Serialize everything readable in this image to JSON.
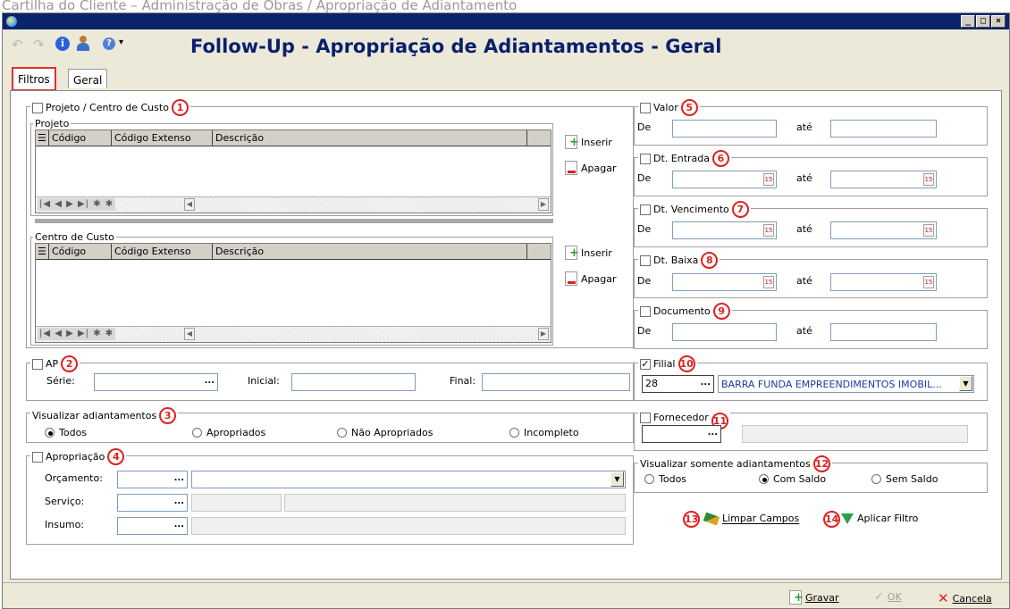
{
  "caption": "Cartilha do Cliente – Administração de Obras / Apropriação de Adiantamento",
  "window": {
    "buttons": [
      "_",
      "□",
      "×"
    ]
  },
  "toolbar": {
    "title": "Follow-Up - Apropriação de Adiantamentos - Geral",
    "help_arrow": "▾"
  },
  "tabs": [
    {
      "label": "Filtros"
    },
    {
      "label": "Geral"
    }
  ],
  "projeto_centro": {
    "label": "Projeto / Centro de Custo",
    "num": "1",
    "projeto": {
      "title": "Projeto",
      "columns": [
        "Código",
        "Código Extenso",
        "Descrição"
      ]
    },
    "centro": {
      "title": "Centro de Custo",
      "columns": [
        "Código",
        "Código Extenso",
        "Descrição"
      ]
    },
    "nav": "|◀ ◀ ▶ ▶| ✱ ✱",
    "inserir": "Inserir",
    "apagar": "Apagar"
  },
  "ap": {
    "label": "AP",
    "num": "2",
    "serie": "Série:",
    "inicial": "Inicial:",
    "final": "Final:",
    "dots": "..."
  },
  "visualizar": {
    "label": "Visualizar adiantamentos",
    "num": "3",
    "options": [
      {
        "label": "Todos",
        "selected": true
      },
      {
        "label": "Apropriados",
        "selected": false
      },
      {
        "label": "Não Apropriados",
        "selected": false
      },
      {
        "label": "Incompleto",
        "selected": false
      }
    ]
  },
  "apropriacao": {
    "label": "Apropriação",
    "num": "4",
    "orcamento": "Orçamento:",
    "servico": "Serviço:",
    "insumo": "Insumo:",
    "dots": "..."
  },
  "valor": {
    "label": "Valor",
    "num": "5",
    "de": "De",
    "ate": "até"
  },
  "dt_entrada": {
    "label": "Dt. Entrada",
    "num": "6",
    "de": "De",
    "ate": "até"
  },
  "dt_vencimento": {
    "label": "Dt. Vencimento",
    "num": "7",
    "de": "De",
    "ate": "até"
  },
  "dt_baixa": {
    "label": "Dt. Baixa",
    "num": "8",
    "de": "De",
    "ate": "até"
  },
  "documento": {
    "label": "Documento",
    "num": "9",
    "de": "De",
    "ate": "até"
  },
  "filial": {
    "label": "Filial",
    "num": "10",
    "checked": "✓",
    "code": "28",
    "dots": "...",
    "name": "BARRA FUNDA EMPREENDIMENTOS IMOBIL..."
  },
  "fornecedor": {
    "label": "Fornecedor",
    "num": "11",
    "dots": "..."
  },
  "somente": {
    "label": "Visualizar somente adiantamentos",
    "num": "12",
    "options": [
      {
        "label": "Todos",
        "selected": false
      },
      {
        "label": "Com Saldo",
        "selected": true
      },
      {
        "label": "Sem Saldo",
        "selected": false
      }
    ]
  },
  "actions": {
    "limpar_num": "13",
    "limpar": "Limpar Campos",
    "aplicar_num": "14",
    "aplicar": "Aplicar Filtro"
  },
  "footer": {
    "gravar": "Gravar",
    "ok": "OK",
    "cancela": "Cancela"
  },
  "cal_text": "15"
}
